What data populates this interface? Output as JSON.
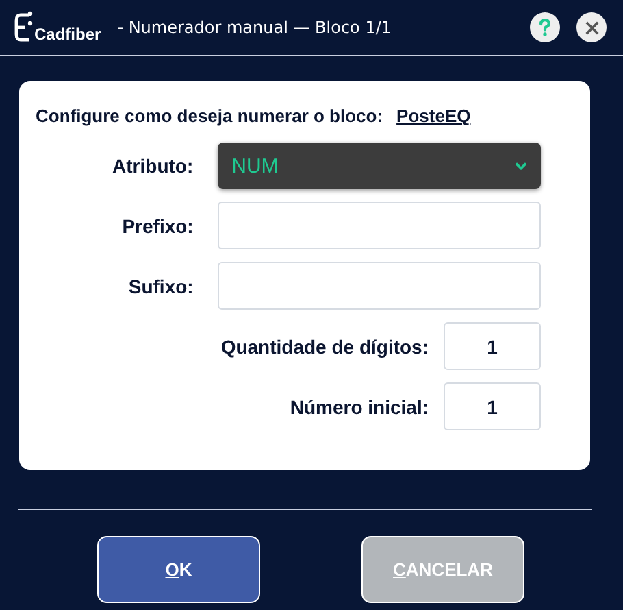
{
  "window": {
    "logo": "Cadfiber",
    "title": "- Numerador manual — Bloco 1/1"
  },
  "form": {
    "heading": "Configure como deseja numerar o bloco:",
    "block_link": "PosteEQ",
    "fields": [
      {
        "kind": "select",
        "label": "Atributo:",
        "value": "NUM"
      },
      {
        "kind": "text",
        "label": "Prefixo:"
      },
      {
        "kind": "text",
        "label": "Sufixo:"
      },
      {
        "kind": "number",
        "label": "Quantidade de dígitos:",
        "value": "1"
      },
      {
        "kind": "number",
        "label": "Número inicial:",
        "value": "1"
      }
    ]
  },
  "buttons": [
    {
      "mnemonic": "O",
      "rest": "K",
      "disabled": false
    },
    {
      "mnemonic": "C",
      "rest": "ANCELAR",
      "disabled": true
    }
  ]
}
